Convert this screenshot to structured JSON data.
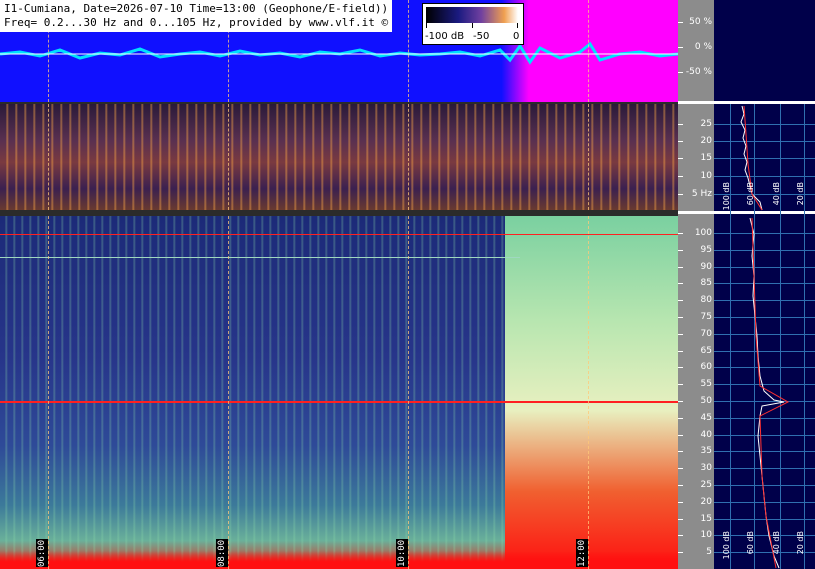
{
  "header": {
    "line1": "I1-Cumiana, Date=2026-07-10 Time=13:00 (Geophone/E-field))",
    "line2": "Freq= 0.2...30 Hz and 0...105 Hz, provided by www.vlf.it ©"
  },
  "scale": {
    "labels": [
      "-100 dB",
      "-50",
      "0"
    ]
  },
  "top_axis": {
    "labels": [
      "50 %",
      "0 %",
      "-50 %"
    ]
  },
  "mid_axis": {
    "labels": [
      "25",
      "20",
      "15",
      "10",
      "5 Hz"
    ]
  },
  "bot_axis": {
    "labels": [
      "100",
      "95",
      "90",
      "85",
      "80",
      "75",
      "70",
      "65",
      "60",
      "55",
      "50",
      "45",
      "40",
      "35",
      "30",
      "25",
      "20",
      "15",
      "10",
      "5"
    ]
  },
  "time_labels": [
    "06:00",
    "08:00",
    "10:00",
    "12:00"
  ],
  "side_labels_mid": [
    "100 dB",
    "60 dB",
    "40 dB",
    "20 dB"
  ],
  "side_labels_bot": [
    "100 dB",
    "60 dB",
    "40 dB",
    "20 dB"
  ],
  "colors": {
    "signal": "#1010ff",
    "storm": "#ff00ff",
    "hum": "#ff2020",
    "side_bg": "#00004a",
    "grid": "#2f6fb0"
  }
}
